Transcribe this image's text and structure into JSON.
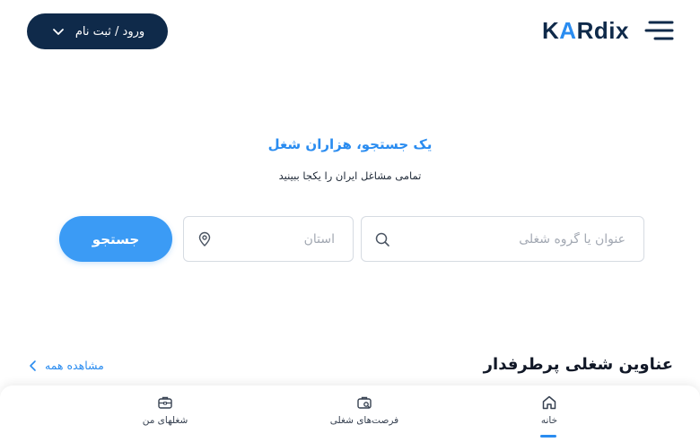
{
  "header": {
    "login_label": "ورود / ثبت نام",
    "logo_prefix": "K",
    "logo_accent": "A",
    "logo_suffix": "Rdix"
  },
  "hero": {
    "title": "یک جستجو، هزاران شغل",
    "subtitle": "تمامی مشاغل ایران را یکجا ببینید"
  },
  "search": {
    "job_placeholder": "عنوان یا گروه شغلی",
    "province_placeholder": "استان",
    "button_label": "جستجو"
  },
  "popular": {
    "title": "عناوین شغلی پرطرفدار",
    "see_all": "مشاهده همه"
  },
  "bottom_nav": {
    "items": [
      {
        "label": "خانه",
        "icon": "home-icon",
        "active": true
      },
      {
        "label": "فرصت‌های شغلی",
        "icon": "job-opportunities-icon",
        "active": false
      },
      {
        "label": "شغلهای من",
        "icon": "briefcase-icon",
        "active": false
      }
    ]
  },
  "colors": {
    "brand_dark": "#0f2a4a",
    "accent": "#2a8cf0",
    "button_blue": "#3b9bf5"
  }
}
